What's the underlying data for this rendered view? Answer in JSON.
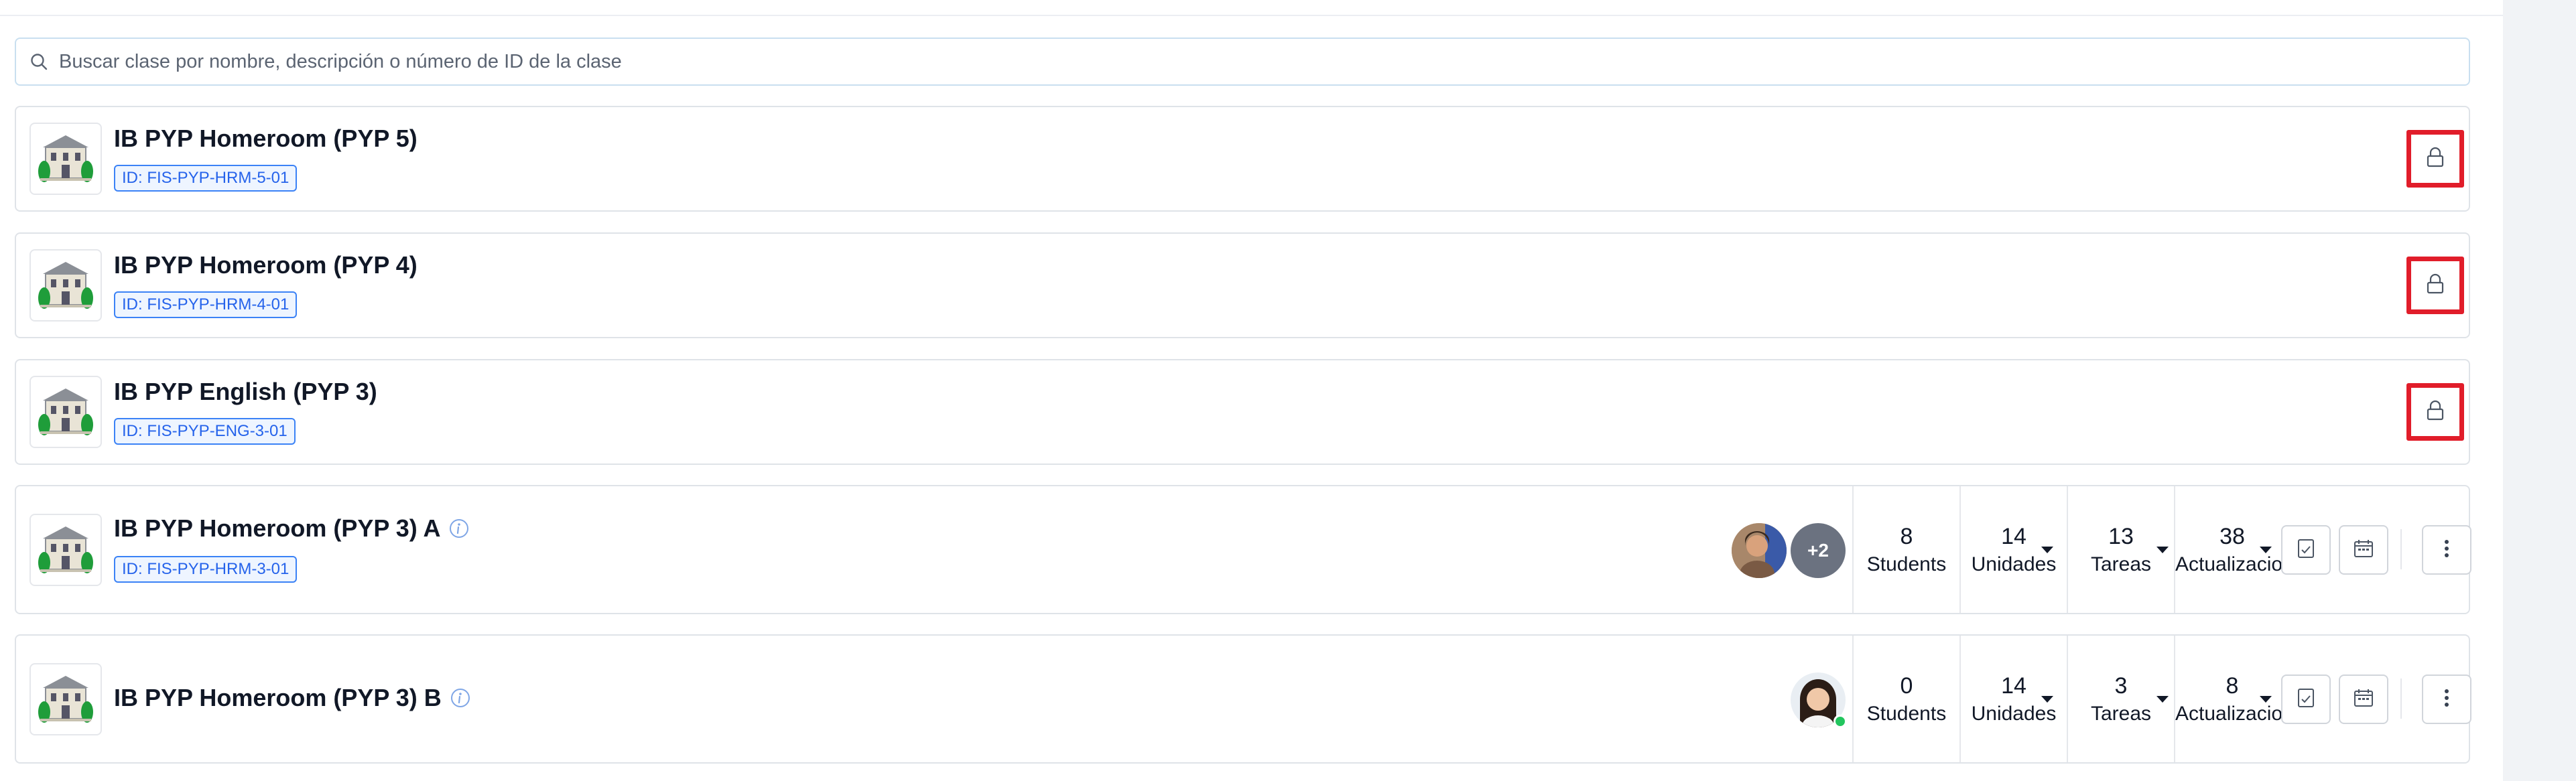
{
  "search": {
    "placeholder": "Buscar clase por nombre, descripción o número de ID de la clase"
  },
  "classes": [
    {
      "title": "IB PYP Homeroom (PYP 5)",
      "id_badge": "ID: FIS-PYP-HRM-5-01",
      "locked": true,
      "thumbnail_icon": "school-building-icon"
    },
    {
      "title": "IB PYP Homeroom (PYP 4)",
      "id_badge": "ID: FIS-PYP-HRM-4-01",
      "locked": true,
      "thumbnail_icon": "school-building-icon"
    },
    {
      "title": "IB PYP English (PYP 3)",
      "id_badge": "ID: FIS-PYP-ENG-3-01",
      "locked": true,
      "thumbnail_icon": "school-building-icon"
    },
    {
      "title": "IB PYP Homeroom (PYP 3) A",
      "id_badge": "ID: FIS-PYP-HRM-3-01",
      "locked": false,
      "extra_teachers": "+2",
      "stats": {
        "students": {
          "value": "8",
          "label": "Students"
        },
        "units": {
          "value": "14",
          "label": "Unidades"
        },
        "tasks": {
          "value": "13",
          "label": "Tareas"
        },
        "updates": {
          "value": "38",
          "label": "Actualizaciones"
        }
      }
    },
    {
      "title": "IB PYP Homeroom (PYP 3) B",
      "locked": false,
      "stats": {
        "students": {
          "value": "0",
          "label": "Students"
        },
        "units": {
          "value": "14",
          "label": "Unidades"
        },
        "tasks": {
          "value": "3",
          "label": "Tareas"
        },
        "updates": {
          "value": "8",
          "label": "Actualizaciones"
        }
      }
    }
  ],
  "colors": {
    "accent_blue": "#2563eb",
    "highlight_red": "#e11d2a",
    "online_green": "#22c55e"
  }
}
